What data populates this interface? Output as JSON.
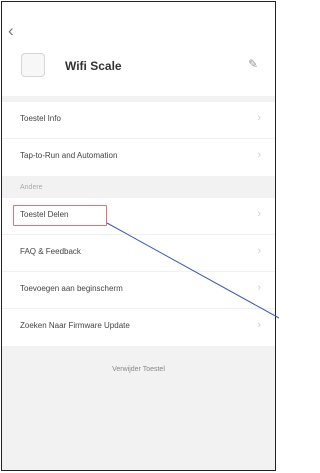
{
  "header": {
    "back_icon": "chevron-left-icon",
    "device_name": "Wifi Scale",
    "edit_icon": "pencil-icon"
  },
  "group1": {
    "items": [
      {
        "label": "Toestel Info"
      },
      {
        "label": "Tap-to-Run and Automation"
      }
    ]
  },
  "section": {
    "label": "Andere"
  },
  "group2": {
    "items": [
      {
        "label": "Toestel Delen"
      },
      {
        "label": "FAQ & Feedback"
      },
      {
        "label": "Toevoegen aan beginscherm"
      },
      {
        "label": "Zoeken Naar Firmware Update"
      }
    ]
  },
  "remove_device": "Verwijder Toestel",
  "annotation": {
    "highlight_color": "#e0707a",
    "line_color": "#3b5bb3"
  }
}
